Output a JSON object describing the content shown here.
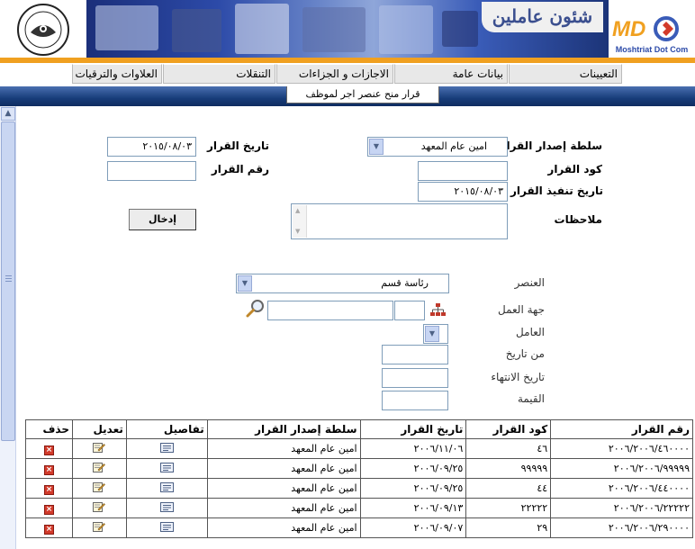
{
  "header": {
    "title": "شئون عاملين",
    "brand_name": "MDC",
    "brand_tagline": "Moshtriat Dot Com"
  },
  "menu": {
    "items": [
      {
        "label": "التعيينات"
      },
      {
        "label": "بيانات عامة"
      },
      {
        "label": "الاجازات و الجزاءات"
      },
      {
        "label": "التنقلات"
      },
      {
        "label": "العلاوات والترقيات"
      }
    ]
  },
  "page_subtitle": "قرار منح عنصر اجر لموظف",
  "form": {
    "authority_label": "سلطة إصدار القرار",
    "authority_value": "امين عام المعهد",
    "decision_code_label": "كود القرار",
    "decision_code_value": "",
    "execution_date_label": "تاريخ تنفيذ القرار",
    "execution_date_value": "٢٠١٥/٠٨/٠٣",
    "notes_label": "ملاحظات",
    "notes_value": "",
    "decision_date_label": "تاريخ القرار",
    "decision_date_value": "٢٠١٥/٠٨/٠٣",
    "decision_number_label": "رقم القرار",
    "decision_number_value": "",
    "submit_label": "إدخال"
  },
  "details": {
    "element_label": "العنصر",
    "element_value": "رئاسة قسم",
    "workplace_label": "جهة العمل",
    "workplace_code_value": "",
    "workplace_name_value": "",
    "worker_label": "العامل",
    "worker_value": "",
    "from_date_label": "من تاريخ",
    "from_date_value": "",
    "end_date_label": "تاريخ الانتهاء",
    "end_date_value": "",
    "value_label": "القيمة",
    "value_value": ""
  },
  "table": {
    "headers": [
      "رقم القرار",
      "كود القرار",
      "تاريخ القرار",
      "سلطة إصدار القرار",
      "تفاصيل",
      "تعديل",
      "حذف"
    ],
    "rows": [
      {
        "number": "٢٠٠٦/٢٠٠٦/٤٦٠٠٠٠",
        "code": "٤٦",
        "date": "٢٠٠٦/١١/٠٦",
        "authority": "امين عام المعهد"
      },
      {
        "number": "٢٠٠٦/٢٠٠٦/٩٩٩٩٩",
        "code": "٩٩٩٩٩",
        "date": "٢٠٠٦/٠٩/٢٥",
        "authority": "امين عام المعهد"
      },
      {
        "number": "٢٠٠٦/٢٠٠٦/٤٤٠٠٠٠",
        "code": "٤٤",
        "date": "٢٠٠٦/٠٩/٢٥",
        "authority": "امين عام المعهد"
      },
      {
        "number": "٢٠٠٦/٢٠٠٦/٢٢٢٢٢",
        "code": "٢٢٢٢٢",
        "date": "٢٠٠٦/٠٩/١٣",
        "authority": "امين عام المعهد"
      },
      {
        "number": "٢٠٠٦/٢٠٠٦/٢٩٠٠٠٠",
        "code": "٢٩",
        "date": "٢٠٠٦/٠٩/٠٧",
        "authority": "امين عام المعهد"
      }
    ]
  },
  "colors": {
    "orange_bar": "#f0a020",
    "blue_band": "#173d7a",
    "delete_red": "#d23a2a"
  }
}
